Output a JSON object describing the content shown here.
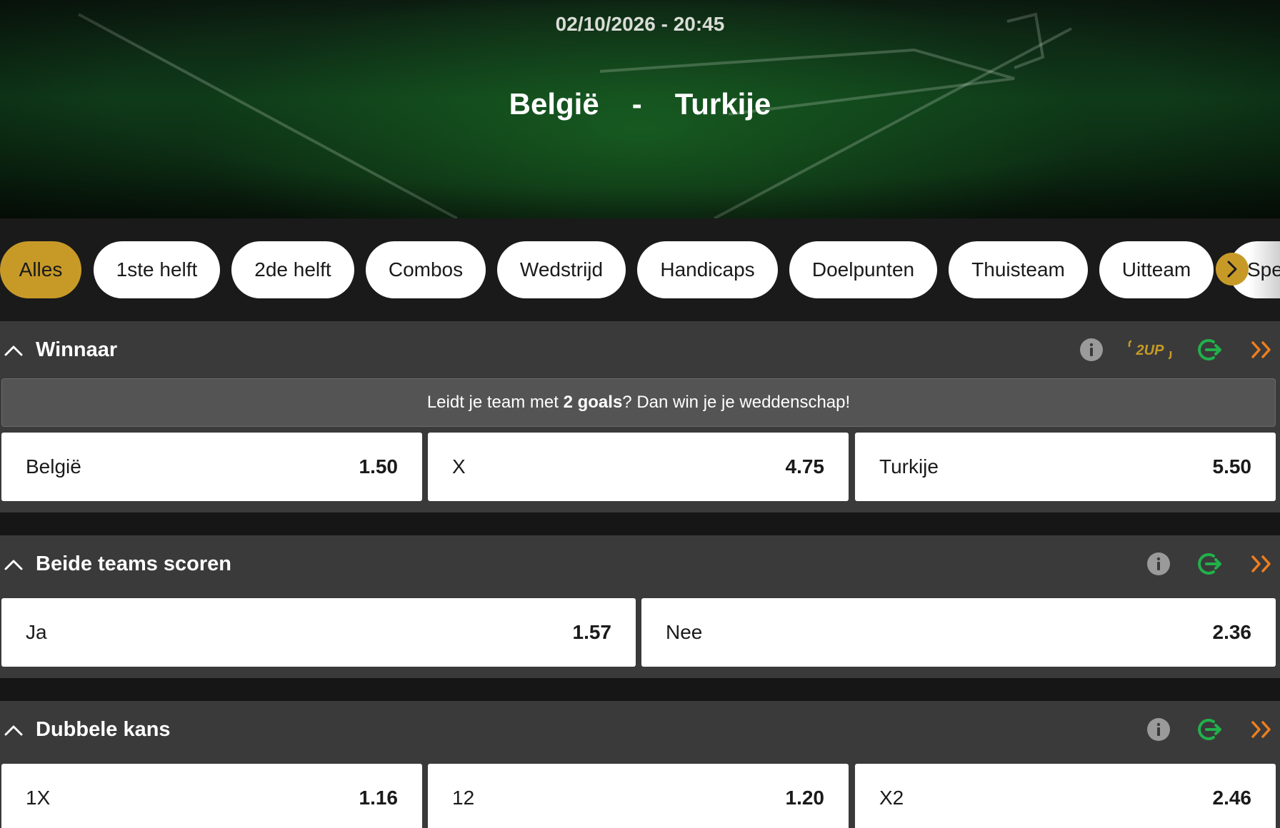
{
  "hero": {
    "datetime": "02/10/2026 - 20:45",
    "home": "België",
    "separator": "-",
    "away": "Turkije"
  },
  "tabs": [
    {
      "label": "Alles",
      "active": true
    },
    {
      "label": "1ste helft"
    },
    {
      "label": "2de helft"
    },
    {
      "label": "Combos"
    },
    {
      "label": "Wedstrijd"
    },
    {
      "label": "Handicaps"
    },
    {
      "label": "Doelpunten"
    },
    {
      "label": "Thuisteam"
    },
    {
      "label": "Uitteam"
    },
    {
      "label": "Spe"
    }
  ],
  "colors": {
    "accent": "#c79a28",
    "green": "#22b04b",
    "orange": "#f07e1c"
  },
  "markets": {
    "winnaar": {
      "title": "Winnaar",
      "badge": "2UP",
      "promo_pre": "Leidt je team met ",
      "promo_bold": "2 goals",
      "promo_post": "? Dan win je je weddenschap!",
      "odds": [
        {
          "label": "België",
          "value": "1.50"
        },
        {
          "label": "X",
          "value": "4.75"
        },
        {
          "label": "Turkije",
          "value": "5.50"
        }
      ]
    },
    "btts": {
      "title": "Beide teams scoren",
      "odds": [
        {
          "label": "Ja",
          "value": "1.57"
        },
        {
          "label": "Nee",
          "value": "2.36"
        }
      ]
    },
    "dubbele": {
      "title": "Dubbele kans",
      "odds": [
        {
          "label": "1X",
          "value": "1.16"
        },
        {
          "label": "12",
          "value": "1.20"
        },
        {
          "label": "X2",
          "value": "2.46"
        }
      ]
    }
  }
}
